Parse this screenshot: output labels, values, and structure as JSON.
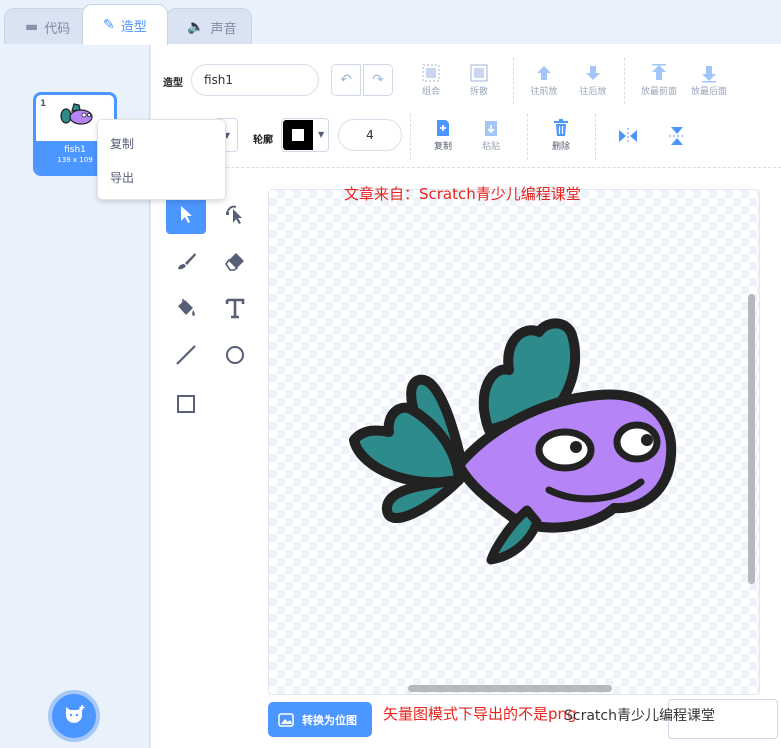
{
  "tabs": [
    {
      "label": "代码",
      "icon": "code-icon"
    },
    {
      "label": "造型",
      "icon": "brush-icon"
    },
    {
      "label": "声音",
      "icon": "speaker-icon"
    }
  ],
  "costume": {
    "number": "1",
    "name": "fish1",
    "size": "139 x 109"
  },
  "context_menu": {
    "items": [
      "复制",
      "导出"
    ]
  },
  "editor": {
    "costume_label": "造型",
    "costume_name": "fish1",
    "outline_label": "轮廓",
    "outline_width": "4",
    "tools_row1": [
      "组合",
      "拆散",
      "往前放",
      "往后放",
      "放最前面",
      "放最后面"
    ],
    "tools_row2": [
      "复制",
      "粘贴",
      "删除"
    ],
    "convert_label": "转换为位图"
  },
  "watermarks": {
    "top": "文章来自：Scratch青少儿编程课堂",
    "bottom": "矢量图模式下导出的不是png",
    "bottom_overlay": "Scratch青少儿编程课堂"
  },
  "colors": {
    "accent": "#4c97ff",
    "fish_body": "#b585f7",
    "fish_fin": "#2e8b8b",
    "watermark": "#e8231c"
  }
}
